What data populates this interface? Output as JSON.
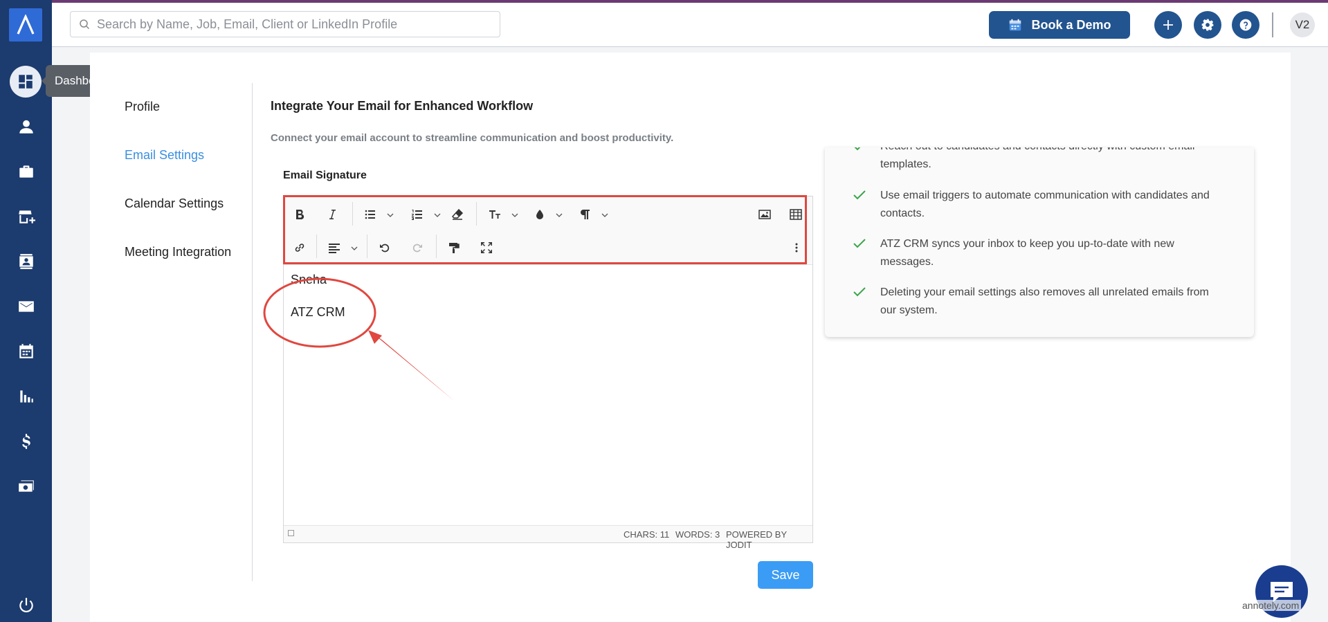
{
  "header": {
    "search_placeholder": "Search by Name, Job, Email, Client or LinkedIn Profile",
    "book_demo_label": "Book a Demo",
    "avatar_text": "V2"
  },
  "sidebar": {
    "tooltip": "Dashboard",
    "items": [
      {
        "icon": "dashboard-icon"
      },
      {
        "icon": "person-icon"
      },
      {
        "icon": "briefcase-icon"
      },
      {
        "icon": "store-add-icon"
      },
      {
        "icon": "contact-card-icon"
      },
      {
        "icon": "mail-icon"
      },
      {
        "icon": "calendar-icon"
      },
      {
        "icon": "bar-chart-icon"
      },
      {
        "icon": "dollar-icon"
      },
      {
        "icon": "money-icon"
      },
      {
        "icon": "power-icon"
      }
    ]
  },
  "settings_menu": {
    "items": [
      "Profile",
      "Email Settings",
      "Calendar Settings",
      "Meeting Integration"
    ],
    "active": "Email Settings"
  },
  "main": {
    "title": "Integrate Your Email for Enhanced Workflow",
    "subtitle": "Connect your email account to streamline communication and boost productivity.",
    "signature_label": "Email Signature",
    "signature_lines": [
      "Sneha",
      "ATZ CRM"
    ],
    "status": {
      "chars": "CHARS: 11",
      "words": "WORDS: 3",
      "powered": "POWERED BY JODIT"
    },
    "save_label": "Save"
  },
  "info_panel": {
    "items": [
      "Reach out to candidates and contacts directly with custom email templates.",
      "Use email triggers to automate communication with candidates and contacts.",
      "ATZ CRM syncs your inbox to keep you up-to-date with new messages.",
      "Deleting your email settings also removes all unrelated emails from our system."
    ]
  },
  "watermark": "annotely.com",
  "colors": {
    "sidebar": "#1c3b6e",
    "primary": "#22548f",
    "accent": "#3a8ee0",
    "annotation": "#e0473f",
    "check": "#3aa54a"
  }
}
